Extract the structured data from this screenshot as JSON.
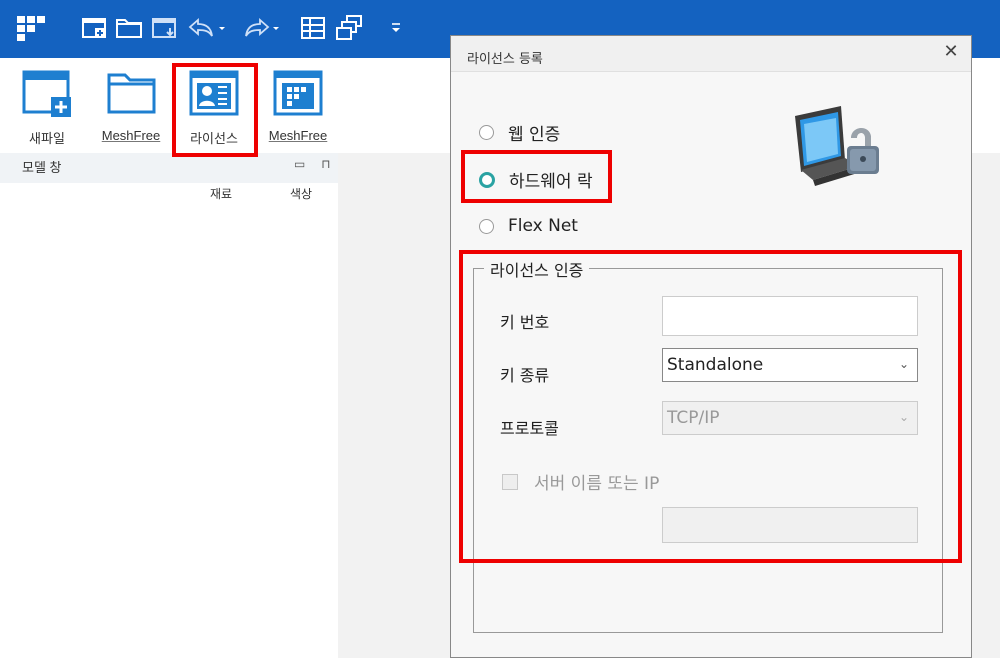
{
  "ribbon": {
    "buttons": [
      {
        "label": "새파일"
      },
      {
        "label": "MeshFree"
      },
      {
        "label": "라이선스"
      },
      {
        "label": "MeshFree"
      }
    ]
  },
  "panel": {
    "title": "모델 창",
    "controls": "▭ ⊓",
    "columns": [
      "재료",
      "색상"
    ]
  },
  "dialog": {
    "title": "라이선스 등록",
    "close": "✕",
    "auth_methods": [
      {
        "label": "웹 인증",
        "selected": false
      },
      {
        "label": "하드웨어 락",
        "selected": true
      },
      {
        "label": "Flex Net",
        "selected": false
      }
    ],
    "license_group": {
      "legend": "라이선스 인증",
      "key_number_label": "키 번호",
      "key_number_value": "",
      "key_type_label": "키 종류",
      "key_type_value": "Standalone",
      "protocol_label": "프로토콜",
      "protocol_value": "TCP/IP",
      "server_checkbox_label": "서버 이름 또는 IP",
      "server_value": ""
    }
  },
  "colors": {
    "title_bar": "#1462c0",
    "highlight": "#ee0000",
    "radio_selected": "#2aa3a3"
  }
}
